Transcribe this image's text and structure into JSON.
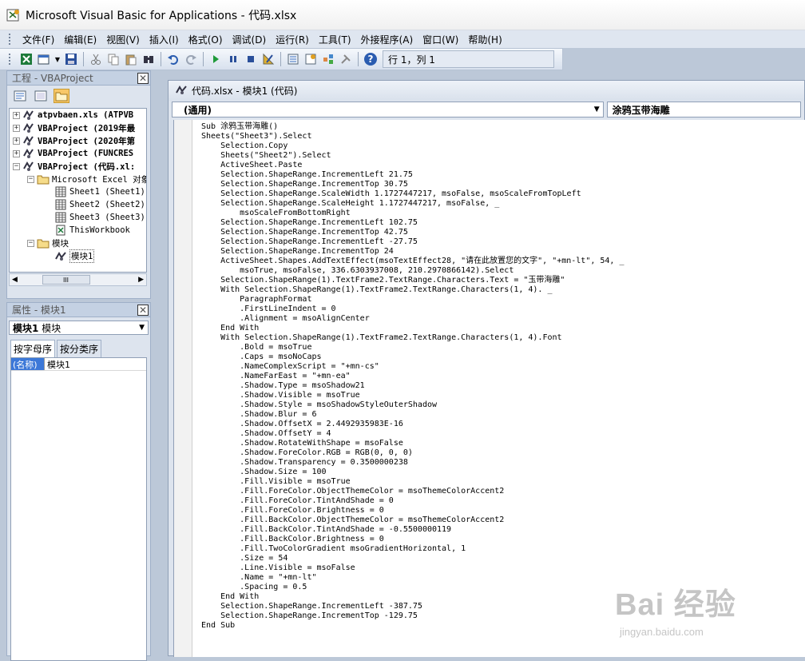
{
  "window": {
    "title": "Microsoft Visual Basic for Applications - 代码.xlsx"
  },
  "menu": [
    "文件(F)",
    "编辑(E)",
    "视图(V)",
    "插入(I)",
    "格式(O)",
    "调试(D)",
    "运行(R)",
    "工具(T)",
    "外接程序(A)",
    "窗口(W)",
    "帮助(H)"
  ],
  "toolbar": {
    "status": "行 1，列 1"
  },
  "project_pane": {
    "title": "工程 - VBAProject",
    "close": "✕",
    "tree": [
      {
        "label": "atpvbaen.xls (ATPVB",
        "bold": true
      },
      {
        "label": "VBAProject (2019年最",
        "bold": true
      },
      {
        "label": "VBAProject (2020年第",
        "bold": true
      },
      {
        "label": "VBAProject (FUNCRES",
        "bold": true
      },
      {
        "label": "VBAProject (代码.xl:",
        "bold": true
      },
      {
        "label": "Microsoft Excel 对象",
        "bold": false
      },
      {
        "label": "Sheet1 (Sheet1)",
        "bold": false
      },
      {
        "label": "Sheet2 (Sheet2)",
        "bold": false
      },
      {
        "label": "Sheet3 (Sheet3)",
        "bold": false
      },
      {
        "label": "ThisWorkbook",
        "bold": false
      },
      {
        "label": "模块",
        "bold": false
      },
      {
        "label": "模块1",
        "bold": false
      }
    ],
    "scroll_thumb": "III"
  },
  "props_pane": {
    "title": "属性 - 模块1",
    "close": "✕",
    "object_name": "模块1",
    "object_type": "模块",
    "tabs": [
      "按字母序",
      "按分类序"
    ],
    "rows": [
      {
        "name": "(名称)",
        "value": "模块1"
      }
    ]
  },
  "code_window": {
    "title": "代码.xlsx - 模块1 (代码)",
    "object_dropdown": "(通用)",
    "proc_dropdown": "涂鸦玉带海雕",
    "lines": [
      "Sub 涂鸦玉带海雕()",
      "Sheets(\"Sheet3\").Select",
      "    Selection.Copy",
      "    Sheets(\"Sheet2\").Select",
      "    ActiveSheet.Paste",
      "    Selection.ShapeRange.IncrementLeft 21.75",
      "    Selection.ShapeRange.IncrementTop 30.75",
      "    Selection.ShapeRange.ScaleWidth 1.1727447217, msoFalse, msoScaleFromTopLeft",
      "    Selection.ShapeRange.ScaleHeight 1.1727447217, msoFalse, _",
      "        msoScaleFromBottomRight",
      "    Selection.ShapeRange.IncrementLeft 102.75",
      "    Selection.ShapeRange.IncrementTop 42.75",
      "    Selection.ShapeRange.IncrementLeft -27.75",
      "    Selection.ShapeRange.IncrementTop 24",
      "    ActiveSheet.Shapes.AddTextEffect(msoTextEffect28, \"请在此放置您的文字\", \"+mn-lt\", 54, _",
      "        msoTrue, msoFalse, 336.6303937008, 210.2970866142).Select",
      "    Selection.ShapeRange(1).TextFrame2.TextRange.Characters.Text = \"玉带海雕\"",
      "    With Selection.ShapeRange(1).TextFrame2.TextRange.Characters(1, 4). _",
      "        ParagraphFormat",
      "        .FirstLineIndent = 0",
      "        .Alignment = msoAlignCenter",
      "    End With",
      "    With Selection.ShapeRange(1).TextFrame2.TextRange.Characters(1, 4).Font",
      "        .Bold = msoTrue",
      "        .Caps = msoNoCaps",
      "        .NameComplexScript = \"+mn-cs\"",
      "        .NameFarEast = \"+mn-ea\"",
      "        .Shadow.Type = msoShadow21",
      "        .Shadow.Visible = msoTrue",
      "        .Shadow.Style = msoShadowStyleOuterShadow",
      "        .Shadow.Blur = 6",
      "        .Shadow.OffsetX = 2.4492935983E-16",
      "        .Shadow.OffsetY = 4",
      "        .Shadow.RotateWithShape = msoFalse",
      "        .Shadow.ForeColor.RGB = RGB(0, 0, 0)",
      "        .Shadow.Transparency = 0.3500000238",
      "        .Shadow.Size = 100",
      "        .Fill.Visible = msoTrue",
      "        .Fill.ForeColor.ObjectThemeColor = msoThemeColorAccent2",
      "        .Fill.ForeColor.TintAndShade = 0",
      "        .Fill.ForeColor.Brightness = 0",
      "        .Fill.BackColor.ObjectThemeColor = msoThemeColorAccent2",
      "        .Fill.BackColor.TintAndShade = -0.5500000119",
      "        .Fill.BackColor.Brightness = 0",
      "        .Fill.TwoColorGradient msoGradientHorizontal, 1",
      "        .Size = 54",
      "        .Line.Visible = msoFalse",
      "        .Name = \"+mn-lt\"",
      "        .Spacing = 0.5",
      "    End With",
      "    Selection.ShapeRange.IncrementLeft -387.75",
      "    Selection.ShapeRange.IncrementTop -129.75",
      "End Sub"
    ]
  },
  "watermark": {
    "main": "Bai 经验",
    "sub": "jingyan.baidu.com"
  }
}
